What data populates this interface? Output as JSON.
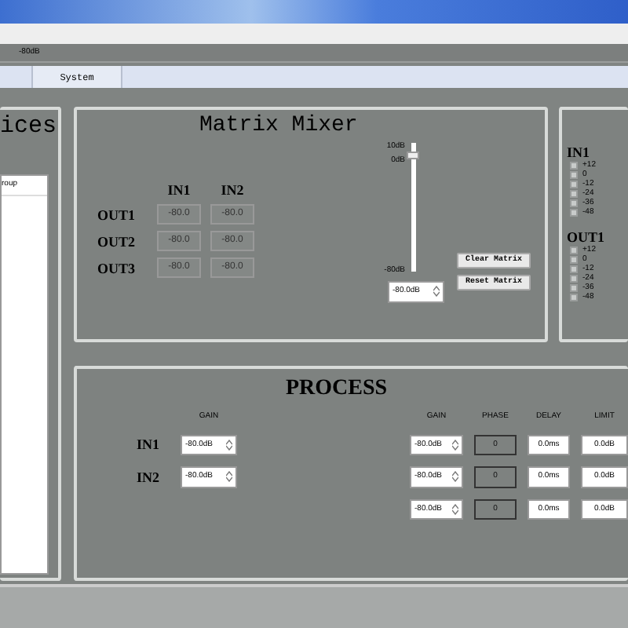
{
  "toolbar": {
    "level_text": "-80dB"
  },
  "tabs": [
    {
      "label": "System",
      "selected": false
    }
  ],
  "devices_panel": {
    "title": "ices",
    "items": [
      {
        "label": "roup"
      }
    ]
  },
  "matrix_mixer": {
    "title": "Matrix Mixer",
    "columns": [
      "IN1",
      "IN2"
    ],
    "rows": [
      {
        "label": "OUT1",
        "cells": [
          "-80.0",
          "-80.0"
        ]
      },
      {
        "label": "OUT2",
        "cells": [
          "-80.0",
          "-80.0"
        ]
      },
      {
        "label": "OUT3",
        "cells": [
          "-80.0",
          "-80.0"
        ]
      }
    ],
    "fader": {
      "top_label": "10dB",
      "mid_label": "0dB",
      "bottom_label": "-80dB",
      "level": 0.9
    },
    "gain_value": "-80.0dB",
    "buttons": [
      "Clear Matrix",
      "Reset Matrix"
    ]
  },
  "meters_panel": {
    "groups": [
      {
        "label": "IN1",
        "leds": [
          "+12",
          "0",
          "-12",
          "-24",
          "-36",
          "-48"
        ]
      },
      {
        "label": "OUT1",
        "leds": [
          "+12",
          "0",
          "-12",
          "-24",
          "-36",
          "-48"
        ]
      }
    ]
  },
  "process": {
    "title": "PROCESS",
    "inputs": {
      "header": "GAIN",
      "rows": [
        {
          "label": "IN1",
          "gain": "-80.0dB"
        },
        {
          "label": "IN2",
          "gain": "-80.0dB"
        }
      ]
    },
    "outputs": {
      "headers": [
        "GAIN",
        "PHASE",
        "DELAY",
        "LIMIT"
      ],
      "rows": [
        {
          "gain": "-80.0dB",
          "phase": "0",
          "delay": "0.0ms",
          "limit": "0.0dB"
        },
        {
          "gain": "-80.0dB",
          "phase": "0",
          "delay": "0.0ms",
          "limit": "0.0dB"
        },
        {
          "gain": "-80.0dB",
          "phase": "0",
          "delay": "0.0ms",
          "limit": "0.0dB"
        }
      ]
    }
  }
}
